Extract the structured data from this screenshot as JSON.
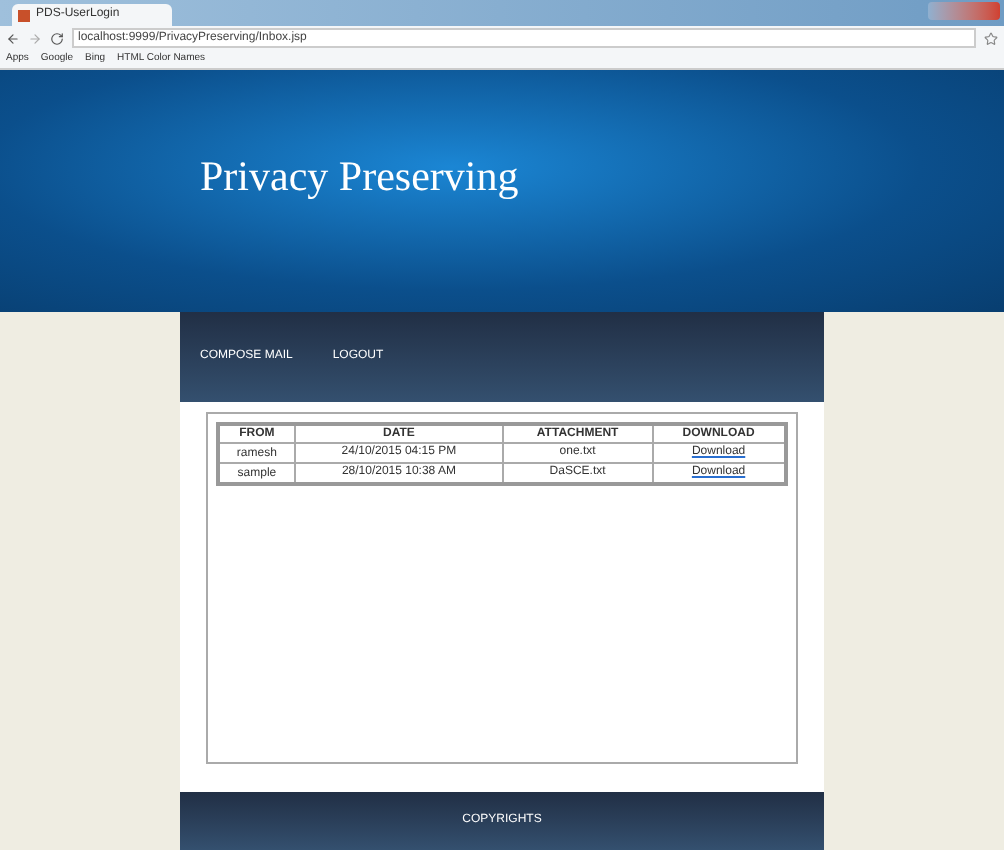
{
  "browser": {
    "tab_title": "PDS-UserLogin",
    "address": "localhost:9999/PrivacyPreserving/Inbox.jsp",
    "bookmarks": [
      "Apps",
      "Google",
      "Bing",
      "HTML Color Names"
    ]
  },
  "header": {
    "title": "Privacy Preserving"
  },
  "nav": [
    "COMPOSE MAIL",
    "LOGOUT"
  ],
  "table": {
    "columns": [
      "FROM",
      "DATE",
      "ATTACHMENT",
      "DOWNLOAD"
    ],
    "rows": [
      {
        "from": "ramesh",
        "date": "24/10/2015 04:15 PM",
        "attachment": "one.txt",
        "download": "Download"
      },
      {
        "from": "sample",
        "date": "28/10/2015 10:38 AM",
        "attachment": "DaSCE.txt",
        "download": "Download"
      }
    ]
  },
  "footer": {
    "text": "COPYRIGHTS"
  }
}
